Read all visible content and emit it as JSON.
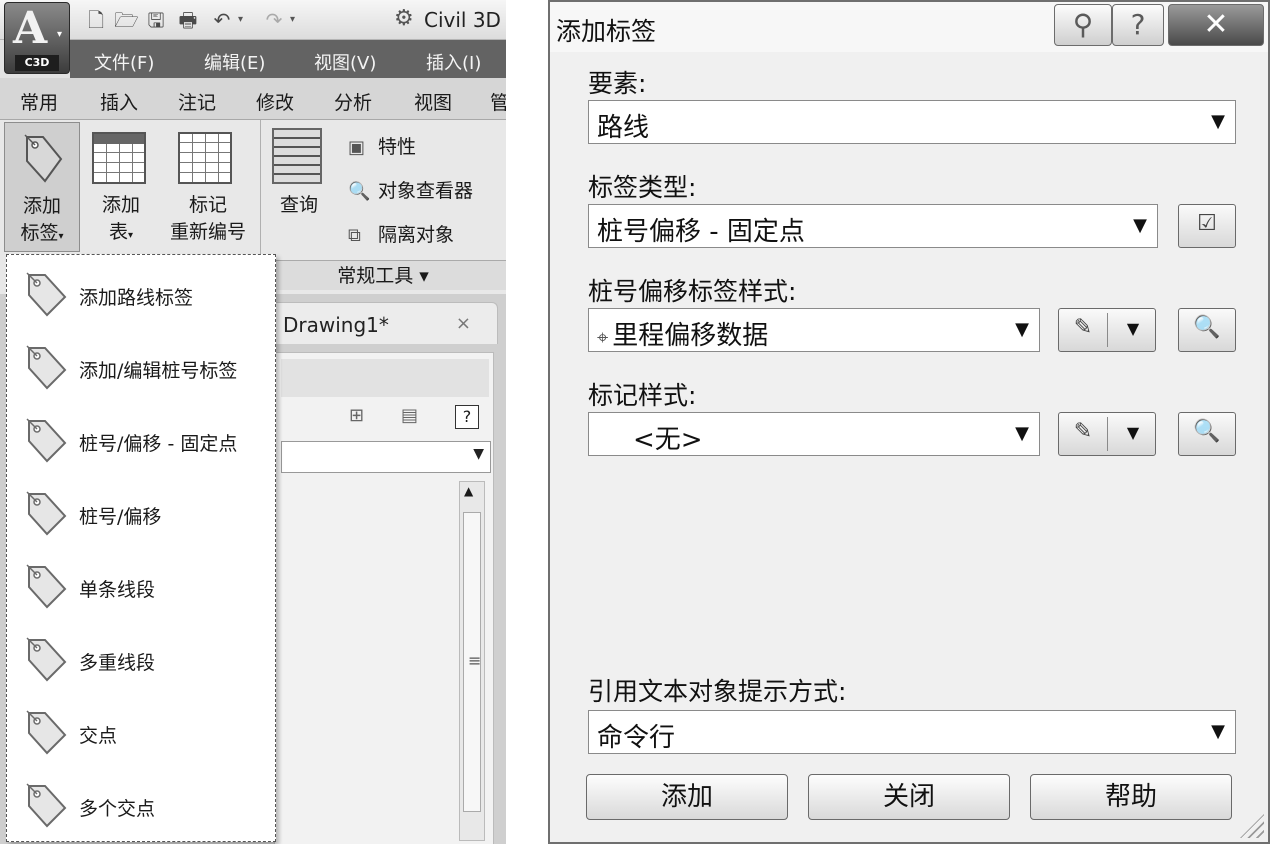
{
  "app": {
    "logo_text": "C3D",
    "workspace": "Civil 3D",
    "menu": [
      "文件(F)",
      "编辑(E)",
      "视图(V)",
      "插入(I)"
    ],
    "tabs": [
      "常用",
      "插入",
      "注记",
      "修改",
      "分析",
      "视图",
      "管"
    ],
    "ribbon": {
      "add_label": [
        "添加",
        "标签"
      ],
      "add_table": [
        "添加",
        "表"
      ],
      "renumber": [
        "标记",
        "重新编号"
      ],
      "query": "查询",
      "properties": "特性",
      "object_viewer": "对象查看器",
      "isolate": "隔离对象",
      "panel_title": "常规工具 ▾"
    },
    "document_tab": "Drawing1*",
    "dropdown_items": [
      "添加路线标签",
      "添加/编辑桩号标签",
      "桩号/偏移 - 固定点",
      "桩号/偏移",
      "单条线段",
      "多重线段",
      "交点",
      "多个交点"
    ]
  },
  "dialog": {
    "title": "添加标签",
    "feature_label": "要素:",
    "feature_value": "路线",
    "label_type_label": "标签类型:",
    "label_type_value": "桩号偏移 - 固定点",
    "station_style_label": "桩号偏移标签样式:",
    "station_style_value": "里程偏移数据",
    "marker_style_label": "标记样式:",
    "marker_style_value": "<无>",
    "reference_prompt_label": "引用文本对象提示方式:",
    "reference_prompt_value": "命令行",
    "buttons": {
      "add": "添加",
      "close": "关闭",
      "help": "帮助"
    }
  }
}
